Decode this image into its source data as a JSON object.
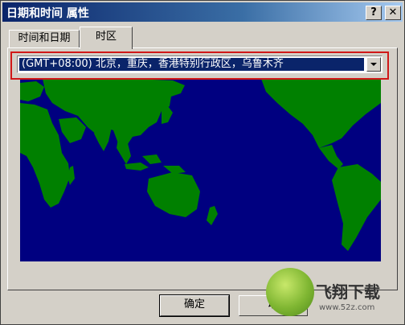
{
  "window": {
    "title": "日期和时间 属性",
    "help_label": "?",
    "close_label": "✕"
  },
  "tabs": [
    {
      "label": "时间和日期",
      "active": false
    },
    {
      "label": "时区",
      "active": true
    }
  ],
  "timezone": {
    "selected": "(GMT+08:00) 北京，重庆，香港特别行政区，乌鲁木齐"
  },
  "map": {
    "ocean_color": "#000080",
    "land_color": "#008000"
  },
  "buttons": {
    "ok": "确定",
    "cancel": "取"
  },
  "watermark": {
    "brand": "飞翔下载",
    "url": "www.52z.com"
  },
  "colors": {
    "highlight": "#d01818",
    "selection": "#0a246a"
  }
}
